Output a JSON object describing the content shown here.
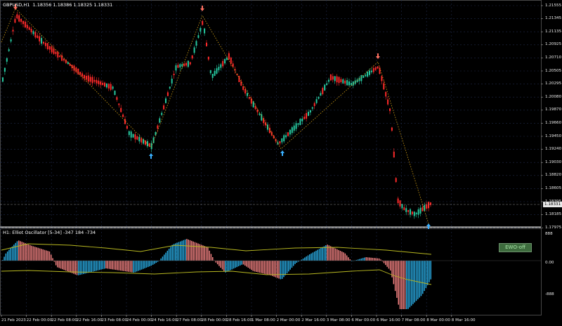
{
  "main_header": {
    "symbol_tf": "GBPUSD,H1",
    "ohlc": "1.18356 1.18386 1.18325 1.18331"
  },
  "current_price": "1.18331",
  "price_axis": [
    "1.21555",
    "1.21345",
    "1.21135",
    "1.20925",
    "1.20710",
    "1.20505",
    "1.20295",
    "1.20080",
    "1.19870",
    "1.19660",
    "1.19450",
    "1.19240",
    "1.19030",
    "1.18820",
    "1.18605",
    "1.18395",
    "1.18185",
    "1.17975"
  ],
  "indicator_header": {
    "title": "H1: Elliot Oscillator [5-34]",
    "values": "-347 184 -734"
  },
  "indicator_axis": [
    "888",
    "0.00",
    "-888"
  ],
  "time_axis": [
    "21 Feb 2023",
    "22 Feb 00:00",
    "22 Feb 08:00",
    "22 Feb 16:00",
    "23 Feb 08:00",
    "24 Feb 00:00",
    "24 Feb 16:00",
    "27 Feb 08:00",
    "28 Feb 00:00",
    "28 Feb 16:00",
    "1 Mar 08:00",
    "2 Mar 00:00",
    "2 Mar 16:00",
    "3 Mar 08:00",
    "6 Mar 00:00",
    "6 Mar 16:00",
    "7 Mar 08:00",
    "8 Mar 00:00",
    "8 Mar 16:00"
  ],
  "ewo_button": "EWO-off",
  "colors": {
    "bull": "#26c9a0",
    "bear": "#ff2a2a",
    "zigzag": "#d4a017",
    "osc_pos": "#29a9e0",
    "osc_neg": "#f08080",
    "osc_band": "#b8b820",
    "arrow_up": "#3ab0ff",
    "arrow_down": "#ff7060"
  }
}
